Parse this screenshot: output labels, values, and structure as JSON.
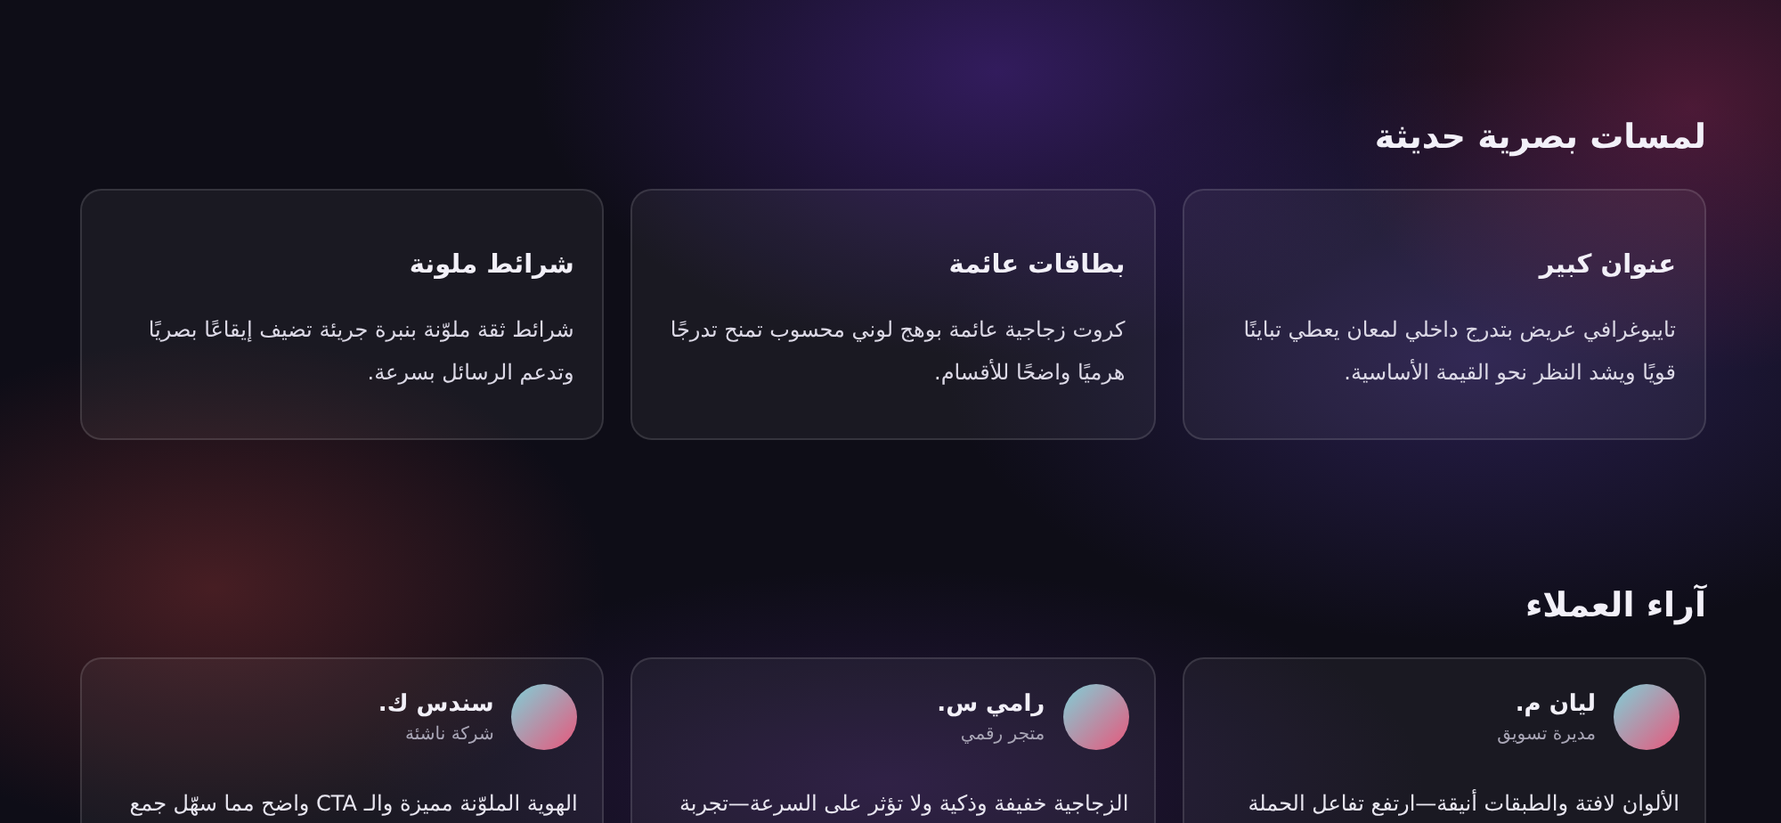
{
  "features": {
    "heading": "لمسات بصرية حديثة",
    "cards": [
      {
        "title": "عنوان كبير",
        "text": "تايبوغرافي عريض بتدرج داخلي لمعان يعطي تباينًا قويًا ويشد النظر نحو القيمة الأساسية."
      },
      {
        "title": "بطاقات عائمة",
        "text": "كروت زجاجية عائمة بوهج لوني محسوب تمنح تدرجًا هرميًا واضحًا للأقسام."
      },
      {
        "title": "شرائط ملونة",
        "text": "شرائط ثقة ملوّنة بنبرة جريئة تضيف إيقاعًا بصريًا وتدعم الرسائل بسرعة."
      }
    ]
  },
  "testimonials": {
    "heading": "آراء العملاء",
    "items": [
      {
        "name": "ليان م.",
        "role": "مديرة تسويق",
        "quote": "الألوان لافتة والطبقات أنيقة—ارتفع تفاعل الحملة"
      },
      {
        "name": "رامي س.",
        "role": "متجر رقمي",
        "quote": "الزجاجية خفيفة وذكية ولا تؤثر على السرعة—تجربة"
      },
      {
        "name": "سندس ك.",
        "role": "شركة ناشئة",
        "quote": "الهوية الملوّنة مميزة والـ CTA واضح مما سهّل جمع"
      }
    ]
  }
}
